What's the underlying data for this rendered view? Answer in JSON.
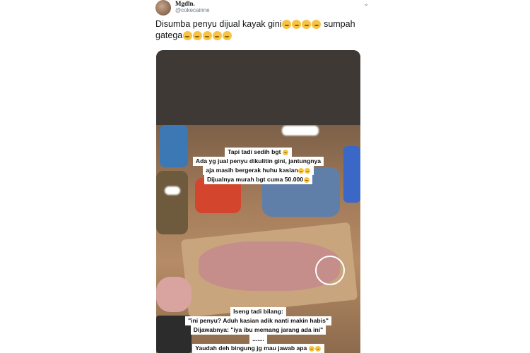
{
  "tweet": {
    "display_name": "Mgdln.",
    "handle": "@cokecainne",
    "text_line1": "Disumba penyu dijual kayak gini",
    "text_line1_tail": "sumpah",
    "text_line2": "gatega",
    "emoji_line1_count": 4,
    "emoji_line2_count": 5
  },
  "media": {
    "caption_top": [
      "Tapi tadi sedih bgt",
      "Ada yg jual penyu dikulitin gini, jantungnya",
      "aja masih bergerak huhu kasian",
      "Dijualnya murah bgt cuma 50.000"
    ],
    "caption_bottom": [
      "Iseng tadi bilang:",
      "\"ini penyu? Aduh kasian adik nanti makin habis\"",
      "Dijawabnya: \"iya ibu memang jarang ada ini\"",
      ".......",
      "Yaudah deh bingung jg mau jawab apa"
    ]
  },
  "colors": {
    "handle_gray": "#657786",
    "emoji_yellow": "#f6c343"
  }
}
